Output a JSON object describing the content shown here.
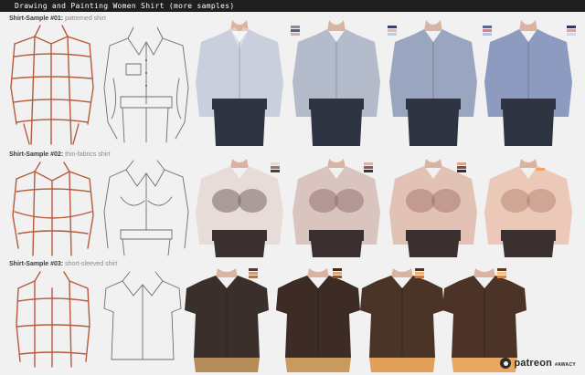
{
  "header": {
    "title": "Drawing and Painting Women Shirt (more samples)"
  },
  "rows": [
    {
      "label": "Shirt-Sample #01:",
      "subtitle": "patterned shirt",
      "shirt_colors": [
        "#c9cfdc",
        "#b4bccc",
        "#9aa6c0",
        "#8d9bc0",
        "#8b98c6"
      ],
      "pants_color": "#2f3443",
      "swatches": [
        [
          "#8a8e9a",
          "#5a6072",
          "#c7b3a5"
        ],
        [
          "#39416a",
          "#d3c2b5",
          "#c3cbe0"
        ],
        [
          "#5a6591",
          "#c98a8f",
          "#b8c3e4"
        ],
        [
          "#30385d",
          "#d9a6a6",
          "#cfd7ef"
        ]
      ]
    },
    {
      "label": "Shirt-Sample #02:",
      "subtitle": "thin-fabrics shirt",
      "shirt_colors": [
        "#e7dcd8",
        "#d9c4c0",
        "#e3c2b6",
        "#ecc8b8",
        "#f0cdb8"
      ],
      "pants_color": "#3a302f",
      "swatches": [
        [
          "#e6dad5",
          "#8c7d7a",
          "#4a3e3c"
        ],
        [
          "#d8b3a8",
          "#7a6461",
          "#3e3231"
        ],
        [
          "#e4a08a",
          "#6e5552",
          "#3b2f2e"
        ],
        [
          "#f4a259"
        ]
      ]
    },
    {
      "label": "Shirt-Sample #03:",
      "subtitle": "short-sleeved shirt",
      "shirt_colors": [
        "#3b2f2b",
        "#3d2c25",
        "#4a3327",
        "#4b3327"
      ],
      "pants_color": "#b58c58",
      "swatches": [
        [
          "#4a3d38",
          "#cf9b7c",
          "#a27c55"
        ],
        [
          "#3d2c26",
          "#e7a56c",
          "#7d5a43"
        ],
        [
          "#4b342a",
          "#f2b26a",
          "#c07a4e"
        ],
        [
          "#5c3a2a",
          "#f7c07a",
          "#d08a55"
        ]
      ]
    }
  ],
  "footer": {
    "brand": "patreon",
    "handle": "#AWACY"
  },
  "colors": {
    "title_bar": "#1f1f1f",
    "background": "#f1f1f1",
    "construction_lines": "#b85a3c",
    "sketch_lines": "#6e6e6e",
    "skin": "#d9b4a3"
  }
}
